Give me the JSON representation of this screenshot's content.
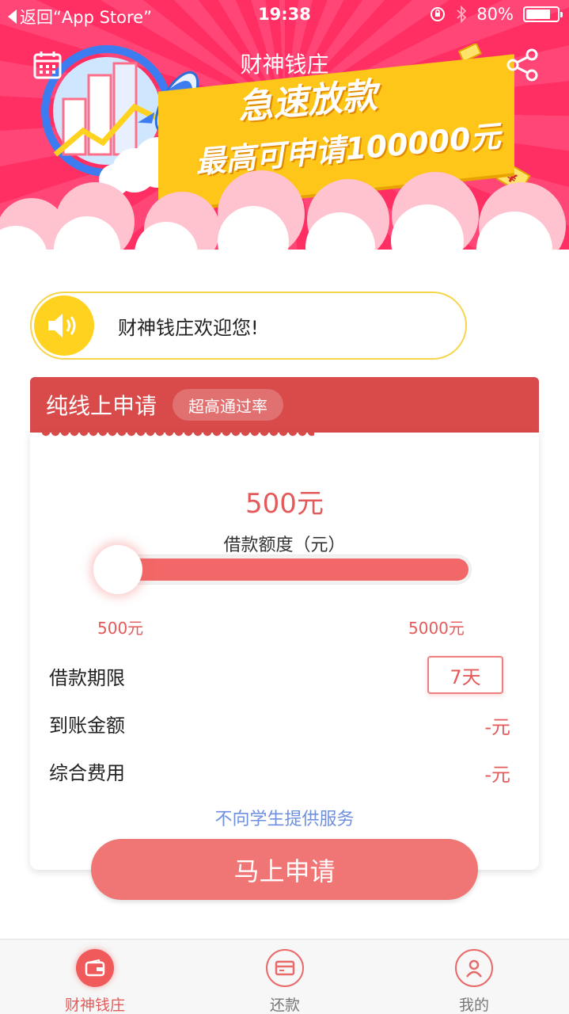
{
  "status_bar": {
    "back_label": "返回“App Store”",
    "time": "19:38",
    "battery_percent": "80%",
    "battery_level": 0.8
  },
  "header": {
    "title": "财神钱庄",
    "calendar_icon": "calendar-icon",
    "share_icon": "share-icon"
  },
  "banner_ad": {
    "headline": "急速放款",
    "subline": "最高可申请100000元"
  },
  "notice": {
    "icon": "speaker-icon",
    "text": "财神钱庄欢迎您!"
  },
  "loan_card": {
    "title": "纯线上申请",
    "badge": "超高通过率",
    "amount_display": "500元",
    "amount_label": "借款额度（元）",
    "slider": {
      "min_label": "500元",
      "max_label": "5000元",
      "value": 500,
      "min": 500,
      "max": 5000
    },
    "rows": [
      {
        "label": "借款期限",
        "value": "7天"
      },
      {
        "label": "到账金额",
        "value": "-元"
      },
      {
        "label": "综合费用",
        "value": "-元"
      }
    ],
    "note": "不向学生提供服务",
    "apply_label": "马上申请"
  },
  "tabs": [
    {
      "label": "财神钱庄",
      "icon": "wallet-icon",
      "active": true
    },
    {
      "label": "还款",
      "icon": "card-icon",
      "active": false
    },
    {
      "label": "我的",
      "icon": "user-icon",
      "active": false
    }
  ],
  "colors": {
    "banner_red": "#ff3a6b",
    "card_header": "#d94a4a",
    "accent": "#e45a5a",
    "button": "#f07575",
    "notice_yellow": "#ffd21f",
    "link_blue": "#6f8fe0"
  }
}
